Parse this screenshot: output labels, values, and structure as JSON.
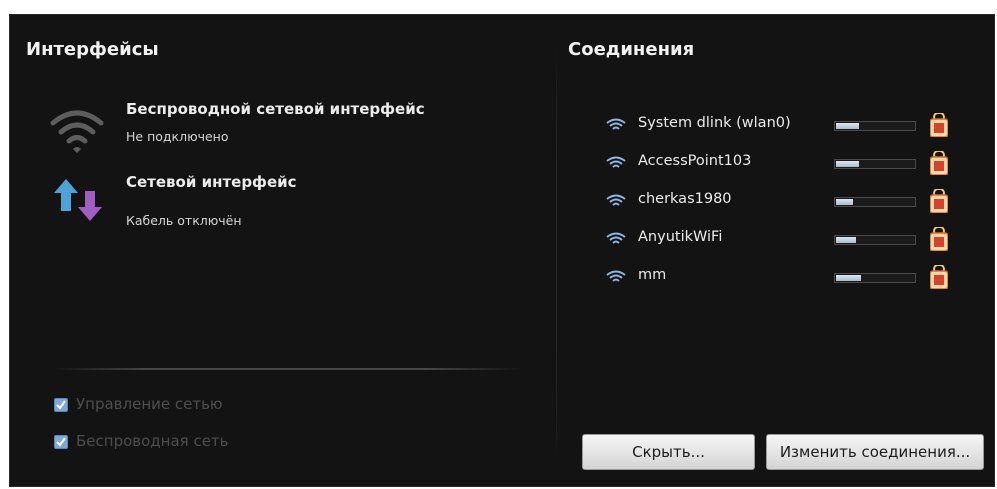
{
  "interfaces_pane": {
    "title": "Интерфейсы",
    "items": [
      {
        "icon": "wifi-icon",
        "name": "Беспроводной сетевой интерфейс",
        "status": "Не подключено"
      },
      {
        "icon": "network-transfer-icon",
        "name": "Сетевой интерфейс",
        "status": "Кабель отключён"
      }
    ],
    "checkboxes": [
      {
        "label": "Управление сетью",
        "checked": true
      },
      {
        "label": "Беспроводная сеть",
        "checked": true
      }
    ]
  },
  "connections_pane": {
    "title": "Соединения",
    "items": [
      {
        "name": "System dlink (wlan0)",
        "signal": 0.3,
        "icon": "wifi-icon",
        "security": "lock-icon"
      },
      {
        "name": "AccessPoint103",
        "signal": 0.3,
        "icon": "wifi-icon",
        "security": "lock-icon"
      },
      {
        "name": "cherkas1980",
        "signal": 0.22,
        "icon": "wifi-icon",
        "security": "lock-icon"
      },
      {
        "name": "AnyutikWiFi",
        "signal": 0.26,
        "icon": "wifi-icon",
        "security": "lock-icon"
      },
      {
        "name": "mm",
        "signal": 0.32,
        "icon": "wifi-icon",
        "security": "lock-icon"
      }
    ],
    "buttons": {
      "hide": "Скрыть...",
      "edit": "Изменить соединения..."
    }
  },
  "colors": {
    "background": "#131313",
    "accent": "#7fa8d8",
    "text": "#ececec"
  }
}
